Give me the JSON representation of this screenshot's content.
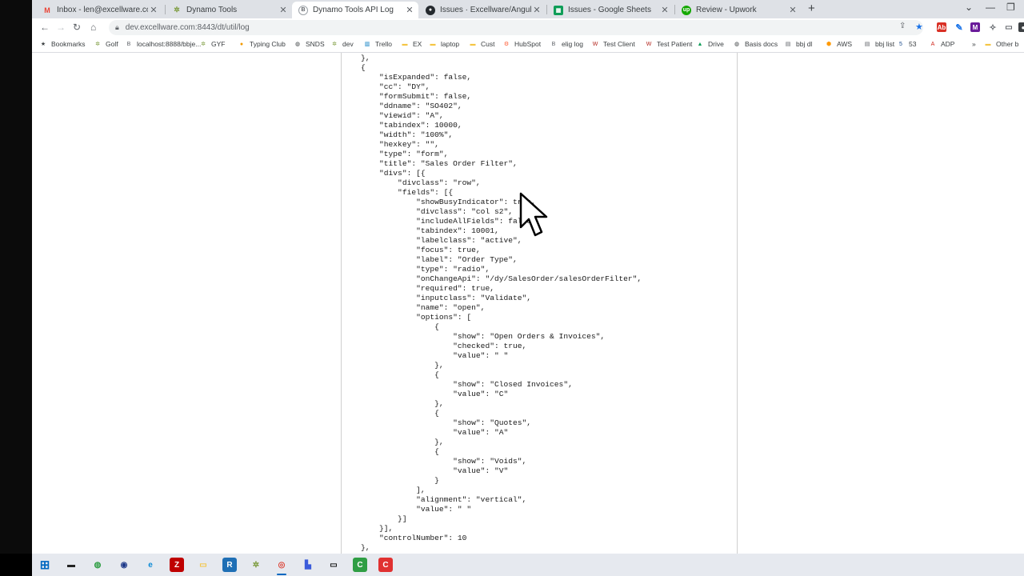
{
  "tabs": [
    {
      "title": "Inbox - len@excellware.com - Ex",
      "icon": "gmail-icon",
      "color": "#ea4335"
    },
    {
      "title": "Dynamo Tools",
      "icon": "dynamo-tools-icon",
      "color": "#7a9a3a"
    },
    {
      "title": "Dynamo Tools API Log",
      "icon": "bbj-icon",
      "color": "#5f6368",
      "active": true
    },
    {
      "title": "Issues · Excellware/Angular",
      "icon": "github-icon",
      "color": "#24292e"
    },
    {
      "title": "Issues - Google Sheets",
      "icon": "sheets-icon",
      "color": "#0f9d58"
    },
    {
      "title": "Review - Upwork",
      "icon": "upwork-icon",
      "color": "#14a800"
    }
  ],
  "toolbar": {
    "url": "dev.excellware.com:8443/dt/util/log"
  },
  "bookmarks": [
    {
      "label": "Bookmarks",
      "icon": "star-icon",
      "color": "#3c4043"
    },
    {
      "label": "Golf",
      "icon": "dynamo-icon",
      "color": "#7a9a3a"
    },
    {
      "label": "localhost:8888/bbje...",
      "icon": "bbj-icon",
      "color": "#5f6368"
    },
    {
      "label": "GYF",
      "icon": "dynamo-icon",
      "color": "#7a9a3a"
    },
    {
      "label": "Typing Club",
      "icon": "typing-club-icon",
      "color": "#f29900"
    },
    {
      "label": "SNDS",
      "icon": "globe-icon",
      "color": "#3c4043"
    },
    {
      "label": "dev",
      "icon": "dynamo-icon",
      "color": "#7a9a3a"
    },
    {
      "label": "Trello",
      "icon": "trello-icon",
      "color": "#0079bf"
    },
    {
      "label": "EX",
      "icon": "folder-icon",
      "color": "#f4c542"
    },
    {
      "label": "laptop",
      "icon": "folder-icon",
      "color": "#f4c542"
    },
    {
      "label": "Cust",
      "icon": "folder-icon",
      "color": "#f4c542"
    },
    {
      "label": "HubSpot",
      "icon": "hubspot-icon",
      "color": "#ff5c35"
    },
    {
      "label": "elig log",
      "icon": "bbj-icon",
      "color": "#5f6368"
    },
    {
      "label": "Test Client",
      "icon": "w-icon",
      "color": "#b3261e"
    },
    {
      "label": "Test Patient",
      "icon": "w-icon",
      "color": "#b3261e"
    },
    {
      "label": "Drive",
      "icon": "drive-icon",
      "color": "#0f9d58"
    },
    {
      "label": "Basis docs",
      "icon": "globe-icon",
      "color": "#3c4043"
    },
    {
      "label": "bbj dl",
      "icon": "bbj-dl-icon",
      "color": "#5f6368"
    },
    {
      "label": "AWS",
      "icon": "aws-icon",
      "color": "#ff9900"
    },
    {
      "label": "bbj list",
      "icon": "bbj-dl-icon",
      "color": "#5f6368"
    },
    {
      "label": "53",
      "icon": "fifth-third-icon",
      "color": "#1a4a8a"
    },
    {
      "label": "ADP",
      "icon": "adp-icon",
      "color": "#d0271d"
    },
    {
      "label": "Other b",
      "icon": "folder-icon",
      "color": "#f4c542"
    }
  ],
  "log_lines": [
    "},",
    "{",
    "    \"isExpanded\": false,",
    "    \"cc\": \"DY\",",
    "    \"formSubmit\": false,",
    "    \"ddname\": \"SO402\",",
    "    \"viewid\": \"A\",",
    "    \"tabindex\": 10000,",
    "    \"width\": \"100%\",",
    "    \"hexkey\": \"\",",
    "    \"type\": \"form\",",
    "    \"title\": \"Sales Order Filter\",",
    "    \"divs\": [{",
    "        \"divclass\": \"row\",",
    "        \"fields\": [{",
    "            \"showBusyIndicator\": true,",
    "            \"divclass\": \"col s2\",",
    "            \"includeAllFields\": false,",
    "            \"tabindex\": 10001,",
    "            \"labelclass\": \"active\",",
    "            \"focus\": true,",
    "            \"label\": \"Order Type\",",
    "            \"type\": \"radio\",",
    "            \"onChangeApi\": \"/dy/SalesOrder/salesOrderFilter\",",
    "            \"required\": true,",
    "            \"inputclass\": \"Validate\",",
    "            \"name\": \"open\",",
    "            \"options\": [",
    "                {",
    "                    \"show\": \"Open Orders & Invoices\",",
    "                    \"checked\": true,",
    "                    \"value\": \" \"",
    "                },",
    "                {",
    "                    \"show\": \"Closed Invoices\",",
    "                    \"value\": \"C\"",
    "                },",
    "                {",
    "                    \"show\": \"Quotes\",",
    "                    \"value\": \"A\"",
    "                },",
    "                {",
    "                    \"show\": \"Voids\",",
    "                    \"value\": \"V\"",
    "                }",
    "            ],",
    "            \"alignment\": \"vertical\",",
    "            \"value\": \" \"",
    "        }]",
    "    }],",
    "    \"controlNumber\": 10",
    "},"
  ],
  "taskbar": [
    {
      "name": "windows-start-icon",
      "color": "#0067c0"
    },
    {
      "name": "terminal-icon",
      "color": "#222222"
    },
    {
      "name": "globe-app-icon",
      "color": "#2f9e44"
    },
    {
      "name": "disc-app-icon",
      "color": "#1e3a8a"
    },
    {
      "name": "edge-icon",
      "color": "#0c8ad6"
    },
    {
      "name": "filezilla-icon",
      "color": "#bf0000"
    },
    {
      "name": "file-explorer-icon",
      "color": "#f4c542"
    },
    {
      "name": "r-app-icon",
      "color": "#1f6fb5"
    },
    {
      "name": "dynamo-app-icon",
      "color": "#7a9a3a"
    },
    {
      "name": "chrome-icon",
      "color": "#db4437",
      "running": true
    },
    {
      "name": "app-icon",
      "color": "#3b5bdb"
    },
    {
      "name": "console-icon",
      "color": "#111111"
    },
    {
      "name": "c-green-icon",
      "color": "#2f9e44"
    },
    {
      "name": "c-red-icon",
      "color": "#e03131"
    }
  ]
}
